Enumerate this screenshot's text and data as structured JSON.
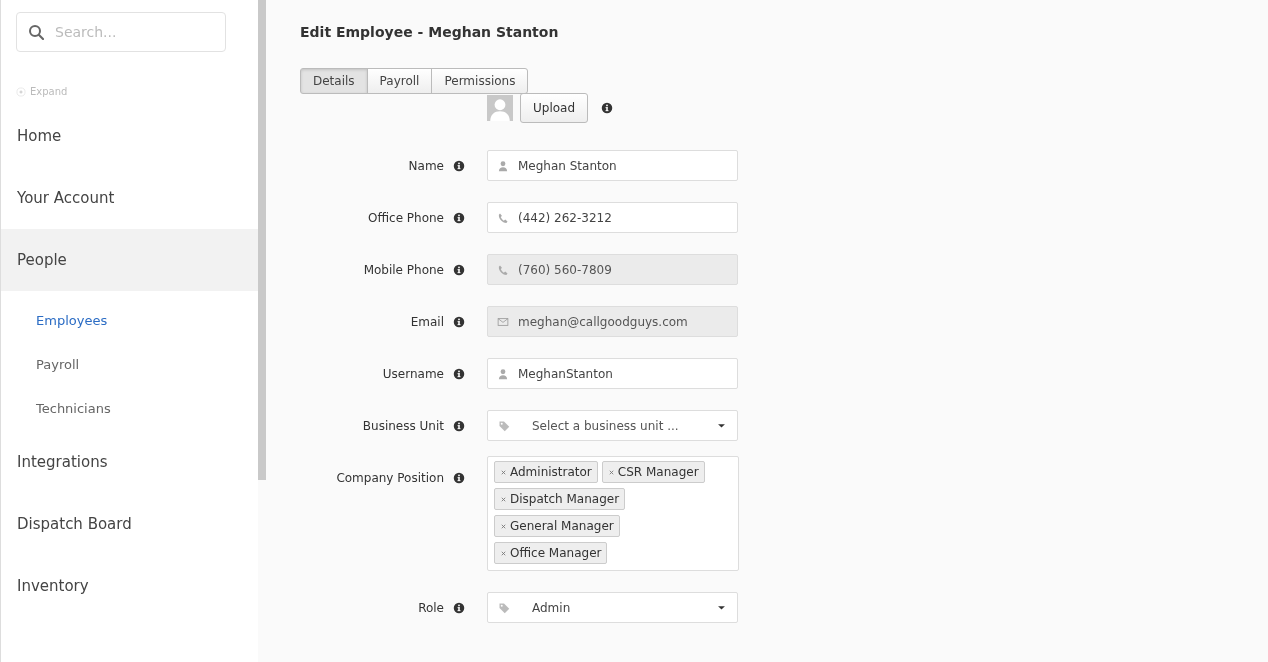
{
  "sidebar": {
    "search": {
      "placeholder": "Search..."
    },
    "expand": "Expand",
    "items": [
      {
        "label": "Home",
        "selected": false
      },
      {
        "label": "Your Account",
        "selected": false
      },
      {
        "label": "People",
        "selected": true,
        "children": [
          {
            "label": "Employees",
            "selected": true
          },
          {
            "label": "Payroll",
            "selected": false
          },
          {
            "label": "Technicians",
            "selected": false
          }
        ]
      },
      {
        "label": "Integrations",
        "selected": false
      },
      {
        "label": "Dispatch Board",
        "selected": false
      },
      {
        "label": "Inventory",
        "selected": false
      }
    ]
  },
  "page": {
    "title": "Edit Employee - Meghan Stanton",
    "tabs": [
      {
        "label": "Details",
        "selected": true
      },
      {
        "label": "Payroll",
        "selected": false
      },
      {
        "label": "Permissions",
        "selected": false
      }
    ],
    "upload": "Upload",
    "fields": [
      {
        "kind": "person",
        "label": "Name",
        "value": "Meghan Stanton",
        "disabled": false
      },
      {
        "kind": "phone",
        "label": "Office Phone",
        "value": "(442) 262-3212",
        "disabled": false
      },
      {
        "kind": "phone",
        "label": "Mobile Phone",
        "value": "(760) 560-7809",
        "disabled": true
      },
      {
        "kind": "email",
        "label": "Email",
        "value": "meghan@callgoodguys.com",
        "disabled": true
      },
      {
        "kind": "person",
        "label": "Username",
        "value": "MeghanStanton",
        "disabled": false
      },
      {
        "kind": "select",
        "label": "Business Unit",
        "placeholder": "Select a business unit ..."
      },
      {
        "kind": "tags",
        "label": "Company Position",
        "tags": [
          "Administrator",
          "CSR Manager",
          "Dispatch Manager",
          "General Manager",
          "Office Manager"
        ]
      },
      {
        "kind": "select",
        "label": "Role",
        "value": "Admin"
      }
    ]
  }
}
